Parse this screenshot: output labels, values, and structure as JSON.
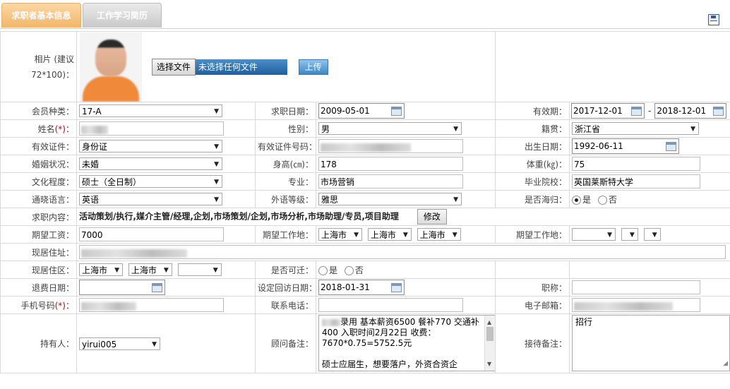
{
  "tabs": [
    "求职者基本信息",
    "工作学习简历"
  ],
  "photo": {
    "label": "相片 (建议72*100)：",
    "choose_label": "选择文件",
    "no_file_label": "未选择任何文件",
    "upload_label": "上传"
  },
  "labels": {
    "member_type": "会员种类：",
    "apply_date": "求职日期：",
    "validity": "有效期：",
    "name": "姓名",
    "gender": "性别：",
    "hometown": "籍贯：",
    "id_type": "有效证件：",
    "id_no": "有效证件号码：",
    "birth": "出生日期：",
    "marital": "婚姻状况：",
    "height": "身高(㎝)：",
    "weight": "体重(㎏)：",
    "education": "文化程度：",
    "major": "专业：",
    "school": "毕业院校：",
    "language": "通晓语言：",
    "foreign_level": "外语等级：",
    "returnee": "是否海归：",
    "job_content": "求职内容：",
    "salary": "期望工资：",
    "work_place": "期望工作地：",
    "work_place2": "期望工作地：",
    "address": "现居住址：",
    "district": "现居住区：",
    "relocate": "是否可迁：",
    "refund_date": "退费日期：",
    "revisit_date": "设定回访日期：",
    "title": "职称：",
    "mobile": "手机号码",
    "phone": "联系电话：",
    "email": "电子邮箱：",
    "holder": "持有人：",
    "consultant_note": "顾问备注：",
    "reception_note": "接待备注："
  },
  "values": {
    "member_type": "17-A",
    "apply_date": "2009-05-01",
    "valid_from": "2017-12-01",
    "valid_sep": "-",
    "valid_to": "2018-12-01",
    "gender": "男",
    "hometown": "浙江省",
    "id_type": "身份证",
    "birth": "1992-06-11",
    "marital": "未婚",
    "height": "178",
    "weight": "75",
    "education": "硕士（全日制）",
    "major": "市场营销",
    "school": "英国莱斯特大学",
    "language": "英语",
    "foreign_level": "雅思",
    "returnee_yes": "是",
    "returnee_no": "否",
    "job_content": "活动策划/执行,媒介主管/经理,企划,市场策划/企划,市场分析,市场助理/专员,项目助理",
    "modify_label": "修改",
    "salary": "7000",
    "work_place": [
      "上海市",
      "上海市",
      "上海市"
    ],
    "district": [
      "上海市",
      "上海市"
    ],
    "relocate_yes": "是",
    "relocate_no": "否",
    "revisit_date": "2018-01-31",
    "holder": "yirui005",
    "required_mark": "(*)",
    "required_colon": "：",
    "consultant_note": "录用 基本薪资6500 餐补770 交通补400 入职时间2月22日 收费：7670*0.75=5752.5元\n\n硕士应届生，想要落户，外资合资企",
    "reception_note": "招行"
  }
}
